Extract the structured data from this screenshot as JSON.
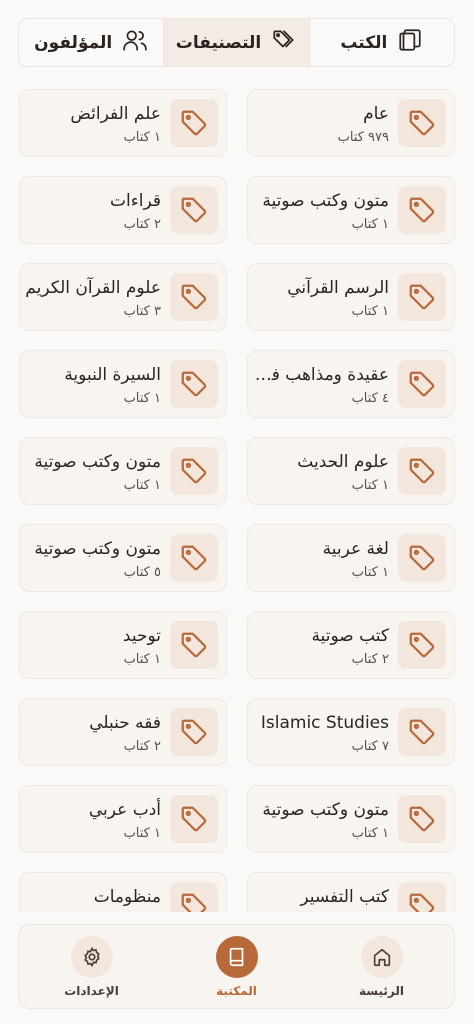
{
  "tabs": [
    {
      "label": "الكتب",
      "icon": "books-icon",
      "active": false
    },
    {
      "label": "التصنيفات",
      "icon": "tags-icon",
      "active": true
    },
    {
      "label": "المؤلفون",
      "icon": "users-icon",
      "active": false
    }
  ],
  "categories": [
    {
      "title": "عام",
      "count": "٩٧٩ كتاب"
    },
    {
      "title": "علم الفرائض",
      "count": "١ كتاب"
    },
    {
      "title": "متون وكتب صوتية",
      "count": "١ كتاب"
    },
    {
      "title": "قراءات",
      "count": "٢ كتاب"
    },
    {
      "title": "الرسم القرآني",
      "count": "١ كتاب"
    },
    {
      "title": "علوم القرآن الكريم",
      "count": "٣ كتاب"
    },
    {
      "title": "عقيدة ومذاهب فكرية",
      "count": "٤ كتاب"
    },
    {
      "title": "السيرة النبوية",
      "count": "١ كتاب"
    },
    {
      "title": "علوم الحديث",
      "count": "١ كتاب"
    },
    {
      "title": "متون وكتب صوتية",
      "count": "١ كتاب"
    },
    {
      "title": "لغة عربية",
      "count": "١ كتاب"
    },
    {
      "title": "متون وكتب صوتية",
      "count": "٥ كتاب"
    },
    {
      "title": "كتب صوتية",
      "count": "٢ كتاب"
    },
    {
      "title": "توحيد",
      "count": "١ كتاب"
    },
    {
      "title": "Islamic Studies",
      "count": "٧ كتاب"
    },
    {
      "title": "فقه حنبلي",
      "count": "٢ كتاب"
    },
    {
      "title": "متون وكتب صوتية",
      "count": "١ كتاب"
    },
    {
      "title": "أدب عربي",
      "count": "١ كتاب"
    },
    {
      "title": "كتب التفسير",
      "count": ""
    },
    {
      "title": "منظومات",
      "count": ""
    }
  ],
  "bottom_nav": [
    {
      "label": "الرئيسة",
      "icon": "home-icon",
      "active": false
    },
    {
      "label": "المكتبة",
      "icon": "book-icon",
      "active": true
    },
    {
      "label": "الإعدادات",
      "icon": "gear-icon",
      "active": false
    }
  ],
  "colors": {
    "accent": "#b8693a",
    "icon_bg": "#f3e6dc",
    "card_bg": "#f8f4f0",
    "page_bg": "#fbf9f7"
  }
}
